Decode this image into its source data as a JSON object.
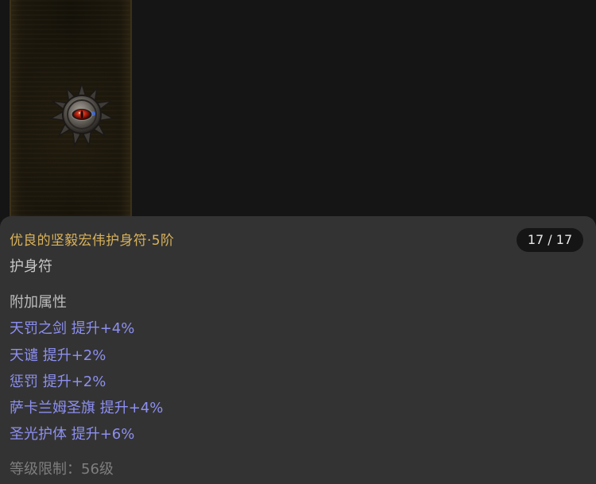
{
  "item": {
    "name": "优良的坚毅宏伟护身符·5阶",
    "type": "护身符",
    "icon": "amulet-icon",
    "page_indicator": "17 / 17",
    "section_title": "附加属性",
    "attributes": [
      "天罚之剑 提升+4%",
      "天谴 提升+2%",
      "惩罚 提升+2%",
      "萨卡兰姆圣旗 提升+4%",
      "圣光护体 提升+6%"
    ],
    "level_requirement": "等级限制：56级"
  },
  "colors": {
    "background": "#151515",
    "tooltip_bg": "#333333",
    "name": "#d9b25a",
    "attribute": "#8d8ff0",
    "muted": "#7e7e7e"
  }
}
